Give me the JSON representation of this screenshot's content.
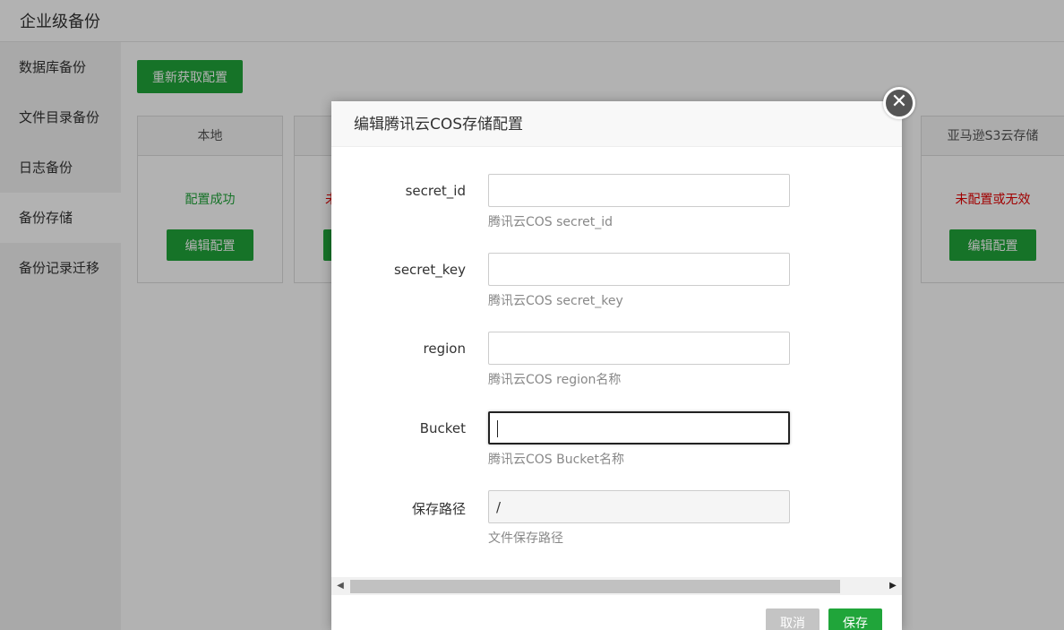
{
  "header": {
    "title": "企业级备份"
  },
  "sidebar": {
    "items": [
      {
        "label": "数据库备份"
      },
      {
        "label": "文件目录备份"
      },
      {
        "label": "日志备份"
      },
      {
        "label": "备份存储"
      },
      {
        "label": "备份记录迁移"
      }
    ]
  },
  "main": {
    "refresh_label": "重新获取配置",
    "cards": [
      {
        "title": "本地",
        "status": "配置成功",
        "button": "编辑配置"
      },
      {
        "title": "",
        "status": "未",
        "button": ""
      },
      {
        "title": "亚马逊S3云存储",
        "status": "未配置或无效",
        "button": "编辑配置"
      }
    ]
  },
  "dialog": {
    "title": "编辑腾讯云COS存储配置",
    "close_symbol": "✕",
    "fields": [
      {
        "label": "secret_id",
        "value": "",
        "hint": "腾讯云COS secret_id"
      },
      {
        "label": "secret_key",
        "value": "",
        "hint": "腾讯云COS secret_key"
      },
      {
        "label": "region",
        "value": "",
        "hint": "腾讯云COS region名称"
      },
      {
        "label": "Bucket",
        "value": "",
        "hint": "腾讯云COS Bucket名称"
      },
      {
        "label": "保存路径",
        "value": "/",
        "hint": "文件保存路径"
      }
    ],
    "cancel_label": "取消",
    "save_label": "保存"
  },
  "colors": {
    "accent": "#20a53a",
    "error": "#e60000"
  }
}
